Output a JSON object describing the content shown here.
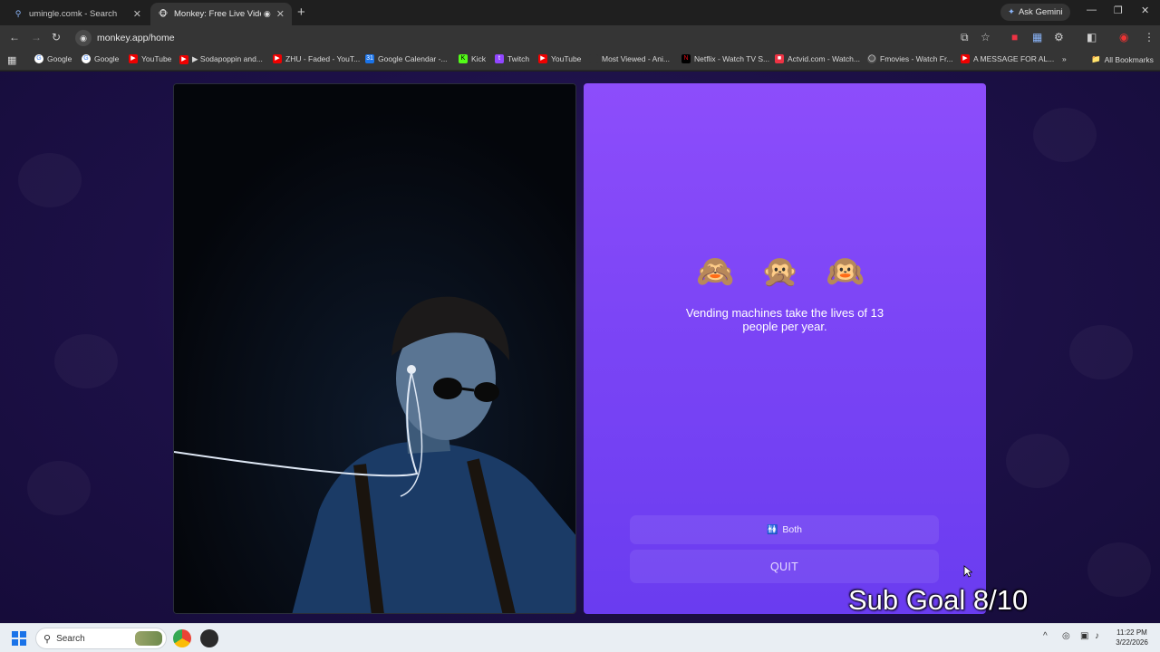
{
  "browser": {
    "tabs": [
      {
        "title": "umingle.comk - Search",
        "icon": "search-icon",
        "active": false
      },
      {
        "title": "Monkey: Free Live Video Ch",
        "icon": "monkey-icon",
        "active": true
      }
    ],
    "ask_gemini": "Ask Gemini",
    "url": "monkey.app/home",
    "bookmarks": [
      {
        "label": "Google",
        "icon": "google-icon"
      },
      {
        "label": "Google",
        "icon": "google-icon"
      },
      {
        "label": "YouTube",
        "icon": "youtube-icon"
      },
      {
        "label": "▶ Sodapoppin and...",
        "icon": "youtube-icon"
      },
      {
        "label": "ZHU - Faded - YouT...",
        "icon": "youtube-icon"
      },
      {
        "label": "Google Calendar -...",
        "icon": "calendar-icon"
      },
      {
        "label": "Kick",
        "icon": "kick-icon"
      },
      {
        "label": "Twitch",
        "icon": "twitch-icon"
      },
      {
        "label": "YouTube",
        "icon": "youtube-icon"
      },
      {
        "label": "Most Viewed - Ani...",
        "icon": "page-icon"
      },
      {
        "label": "Netflix - Watch TV S...",
        "icon": "netflix-icon"
      },
      {
        "label": "Actvid.com - Watch...",
        "icon": "actvid-icon"
      },
      {
        "label": "Fmovies - Watch Fr...",
        "icon": "globe-icon"
      },
      {
        "label": "A MESSAGE FOR AL...",
        "icon": "youtube-icon"
      }
    ],
    "all_bookmarks": "All Bookmarks"
  },
  "chat": {
    "monkeys": "🙈 🙊 🙉",
    "fact": "Vending machines take the lives of 13 people per year.",
    "both_icon": "🚻",
    "both_label": "Both",
    "quit_label": "QUIT"
  },
  "overlay": {
    "sub_goal": "Sub Goal 8/10"
  },
  "taskbar": {
    "search_placeholder": "Search",
    "time": "11:22 PM",
    "date": "3/22/2026"
  },
  "colors": {
    "chat_gradient_top": "#8d4dfb",
    "chat_gradient_bottom": "#6a3cf0",
    "page_bg": "#1c1046"
  }
}
